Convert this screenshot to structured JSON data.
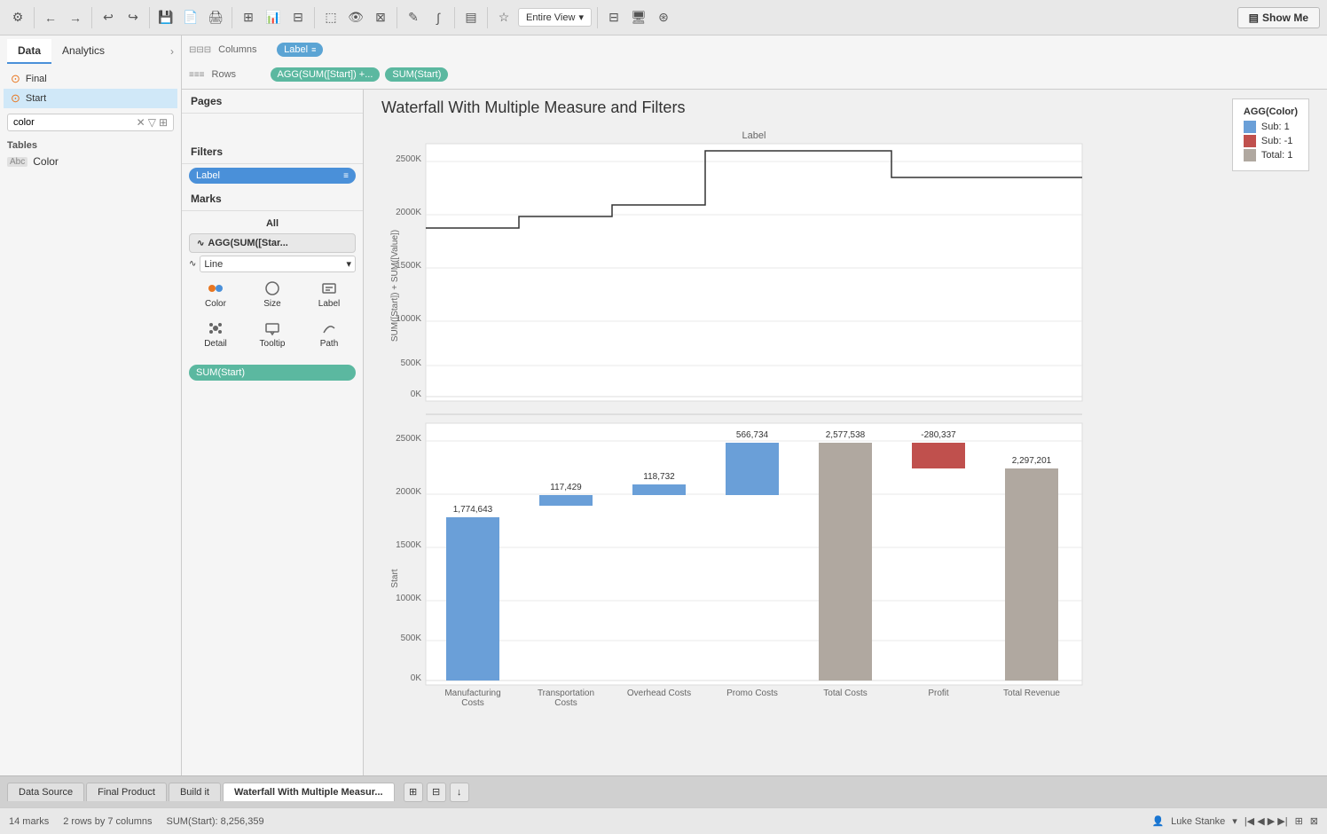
{
  "toolbar": {
    "show_me_label": "Show Me",
    "entire_view_label": "Entire View"
  },
  "left_panel": {
    "tab_data": "Data",
    "tab_analytics": "Analytics",
    "items": [
      {
        "label": "Final",
        "type": "datasource"
      },
      {
        "label": "Start",
        "type": "datasource"
      }
    ],
    "search_value": "color",
    "tables_header": "Tables",
    "fields": [
      {
        "label": "Color",
        "type": "Abc"
      }
    ]
  },
  "viz_panel": {
    "pages_header": "Pages",
    "filters_header": "Filters",
    "filter_label": "Label",
    "marks_header": "Marks",
    "marks_all": "All",
    "marks_pill": "AGG(SUM([Star...",
    "marks_type": "Line",
    "mark_buttons": [
      {
        "label": "Color",
        "icon": "⬤"
      },
      {
        "label": "Size",
        "icon": "◎"
      },
      {
        "label": "Label",
        "icon": "▤"
      },
      {
        "label": "Detail",
        "icon": "⊞"
      },
      {
        "label": "Tooltip",
        "icon": "▭"
      },
      {
        "label": "Path",
        "icon": "∿"
      }
    ],
    "sum_start": "SUM(Start)"
  },
  "shelves": {
    "columns_label": "Columns",
    "rows_label": "Rows",
    "columns_pill": "Label",
    "rows_pill1": "AGG(SUM([Start]) +...",
    "rows_pill2": "SUM(Start)"
  },
  "chart": {
    "title": "Waterfall With Multiple Measure and Filters",
    "x_label": "Label",
    "top_y_label": "SUM([Start]) + SUM([Value])",
    "bottom_y_label": "Start",
    "categories": [
      "Manufacturing Costs",
      "Transportation Costs",
      "Overhead Costs",
      "Promo Costs",
      "Total Costs",
      "Profit",
      "Total Revenue"
    ],
    "top_chart": {
      "label": "Label",
      "line_values": [
        1900000,
        1900000,
        2000000,
        2000000,
        2100000,
        2100000,
        2600000,
        2600000,
        2600000,
        2300000,
        2300000,
        2300000
      ]
    },
    "bars": [
      {
        "label": "Manufacturing Costs",
        "value": 1774643,
        "color": "#6a9fd8",
        "start": 0,
        "height_pct": 0.71
      },
      {
        "label": "Transportation Costs",
        "value": 117429,
        "color": "#6a9fd8",
        "start": 0.71,
        "height_pct": 0.047
      },
      {
        "label": "Overhead Costs",
        "value": 118732,
        "color": "#6a9fd8",
        "start": 0.757,
        "height_pct": 0.047
      },
      {
        "label": "Promo Costs",
        "value": 566734,
        "color": "#6a9fd8",
        "start": 0.804,
        "height_pct": 0.227
      },
      {
        "label": "Total Costs",
        "value": 2577538,
        "color": "#b0a8a0",
        "start": 0,
        "height_pct": 0.97
      },
      {
        "label": "Profit",
        "value": -280337,
        "color": "#c0504d",
        "start": 0.855,
        "height_pct": 0.112
      },
      {
        "label": "Total Revenue",
        "value": 2297201,
        "color": "#b0a8a0",
        "start": 0,
        "height_pct": 0.919
      }
    ]
  },
  "legend": {
    "title": "AGG(Color)",
    "items": [
      {
        "label": "Sub: 1",
        "color": "#6a9fd8"
      },
      {
        "label": "Sub: -1",
        "color": "#c0504d"
      },
      {
        "label": "Total: 1",
        "color": "#b0a8a0"
      }
    ]
  },
  "status_bar": {
    "marks": "14 marks",
    "rows": "2 rows by 7 columns",
    "sum": "SUM(Start): 8,256,359",
    "user": "Luke Stanke"
  },
  "bottom_tabs": [
    {
      "label": "Data Source",
      "active": false
    },
    {
      "label": "Final Product",
      "active": false
    },
    {
      "label": "Build it",
      "active": false
    },
    {
      "label": "Waterfall With Multiple Measur...",
      "active": true
    }
  ]
}
